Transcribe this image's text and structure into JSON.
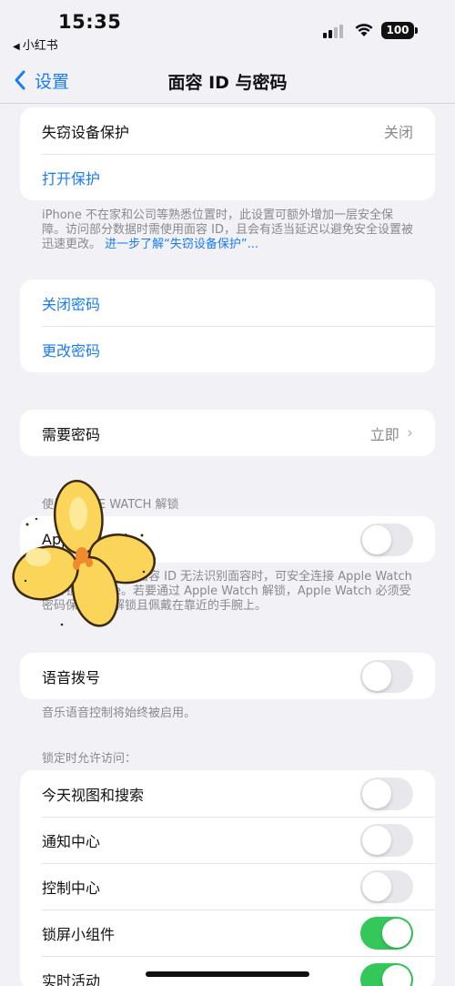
{
  "status_bar": {
    "time": "15:35",
    "back_app": "小红书",
    "battery": "100"
  },
  "nav": {
    "back_label": "设置",
    "title": "面容 ID 与密码"
  },
  "stolen_device": {
    "label": "失窃设备保护",
    "value": "关闭",
    "action": "打开保护",
    "footnote": "iPhone 不在家和公司等熟悉位置时，此设置可额外增加一层安全保障。访问部分数据时需使用面容 ID，且会有适当延迟以避免安全设置被迅速更改。",
    "footnote_link": "进一步了解“失窃设备保护”..."
  },
  "passcode": {
    "turn_off": "关闭密码",
    "change": "更改密码"
  },
  "require": {
    "label": "需要密码",
    "value": "立即"
  },
  "watch": {
    "header": "使用 APPLE WATCH 解锁",
    "label": "Apple Watch",
    "toggle_on": false,
    "footnote": "由于面罩等遮挡，面容 ID 无法识别面容时，可安全连接 Apple Watch 来解锁 iPhone。若要通过 Apple Watch 解锁，Apple Watch 必须受密码保护、已解锁且佩戴在靠近的手腕上。"
  },
  "voice_dial": {
    "label": "语音拨号",
    "toggle_on": false,
    "footnote": "音乐语音控制将始终被启用。"
  },
  "locked_access": {
    "header": "锁定时允许访问：",
    "items": [
      {
        "label": "今天视图和搜索",
        "on": false
      },
      {
        "label": "通知中心",
        "on": false
      },
      {
        "label": "控制中心",
        "on": false
      },
      {
        "label": "锁屏小组件",
        "on": true
      },
      {
        "label": "实时活动",
        "on": true
      }
    ]
  },
  "colors": {
    "accent": "#1a7cf5",
    "toggle_on": "#34c759",
    "background": "#f2f1f6"
  }
}
